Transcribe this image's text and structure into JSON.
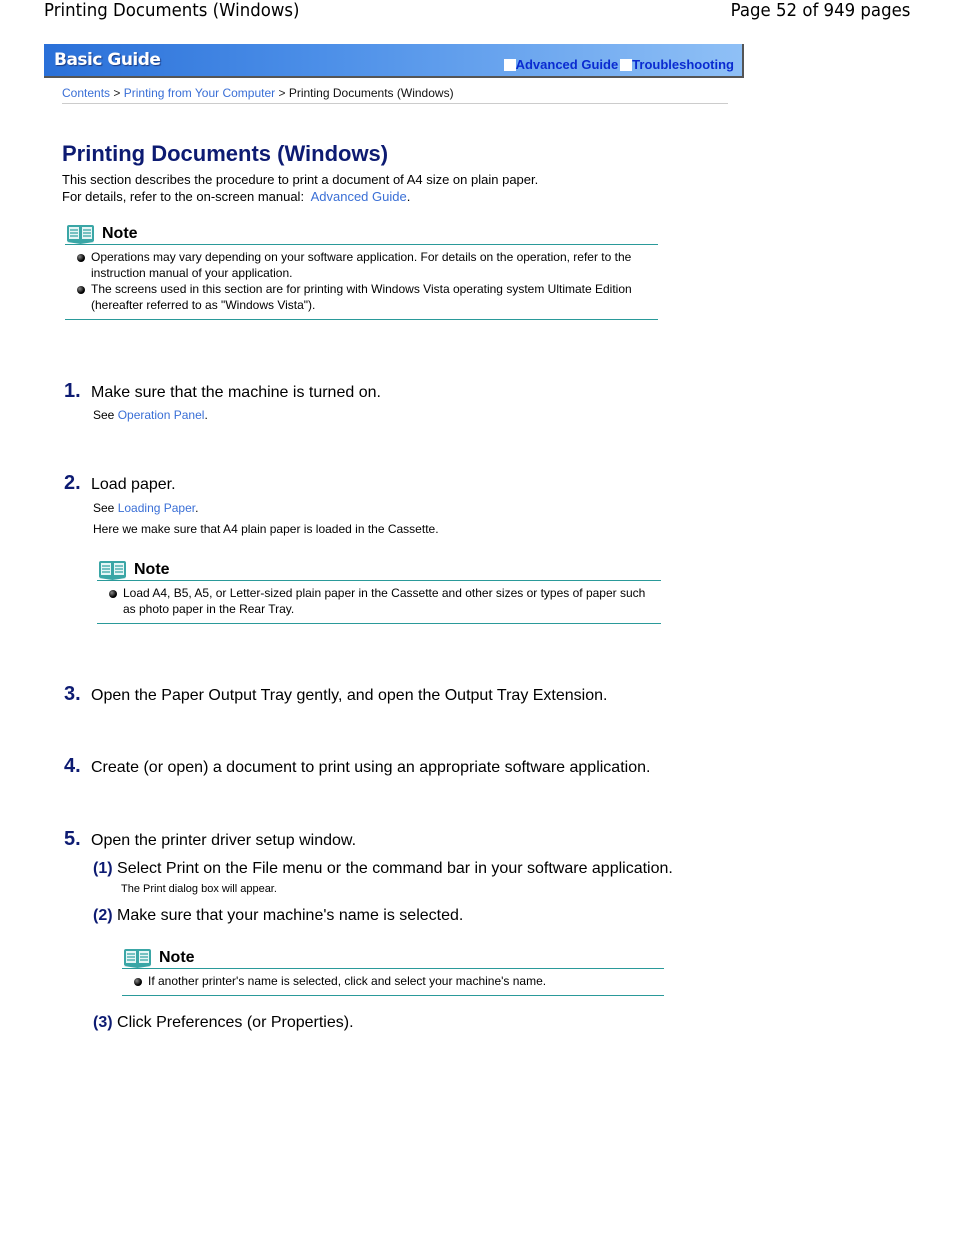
{
  "pdf_header": {
    "title": "Printing Documents (Windows)",
    "page_info": "Page 52 of 949 pages"
  },
  "banner": {
    "title": "Basic Guide",
    "links": [
      {
        "label": "Advanced Guide"
      },
      {
        "label": "Troubleshooting"
      }
    ],
    "colors": {
      "gradient_start": "#2a70d8",
      "gradient_end": "#8fc0f6",
      "link": "#0a2bd0"
    }
  },
  "breadcrumb": {
    "items": [
      {
        "label": "Contents",
        "link": true
      },
      {
        "label": "Printing from Your Computer",
        "link": true
      },
      {
        "label": "Printing Documents (Windows)",
        "link": false
      }
    ],
    "separator": ">"
  },
  "page": {
    "title": "Printing Documents (Windows)",
    "intro_line1": "This section describes the procedure to print a document of A4 size on plain paper.",
    "intro_line2_prefix": "For details, refer to the on-screen manual:",
    "intro_link": "Advanced Guide",
    "intro_suffix": "."
  },
  "notes": [
    {
      "title": "Note",
      "items": [
        "Operations may vary depending on your software application. For details on the operation, refer to the instruction manual of your application.",
        "The screens used in this section are for printing with Windows Vista operating system Ultimate Edition (hereafter referred to as \"Windows Vista\")."
      ]
    },
    {
      "title": "Note",
      "items": [
        "Load A4, B5, A5, or Letter-sized plain paper in the Cassette and other sizes or types of paper such as photo paper in the Rear Tray."
      ]
    },
    {
      "title": "Note",
      "items": [
        "If another printer's name is selected, click and select your machine's name."
      ]
    }
  ],
  "steps": [
    {
      "num": "1.",
      "text": "Make sure that the machine is turned on.",
      "see_prefix": "See",
      "see_link": "Operation Panel",
      "see_suffix": "."
    },
    {
      "num": "2.",
      "text": "Load paper.",
      "see_prefix": "See",
      "see_link": "Loading Paper",
      "see_suffix": ".",
      "extra": "Here we make sure that A4 plain paper is loaded in the Cassette."
    },
    {
      "num": "3.",
      "text": "Open the Paper Output Tray gently, and open the Output Tray Extension."
    },
    {
      "num": "4.",
      "text": "Create (or open) a document to print using an appropriate software application."
    },
    {
      "num": "5.",
      "text": "Open the printer driver setup window.",
      "substeps": [
        {
          "num": "(1)",
          "text": "Select Print on the File menu or the command bar in your software application.",
          "detail": "The Print dialog box will appear."
        },
        {
          "num": "(2)",
          "text": "Make sure that your machine's name is selected."
        },
        {
          "num": "(3)",
          "text": "Click Preferences (or Properties)."
        }
      ]
    }
  ],
  "icons": {
    "note": "open-book-icon",
    "bullet": "round-bullet-icon"
  },
  "colors": {
    "heading": "#0d1b72",
    "link": "#3a6fd6",
    "note_rule": "#2a9a9a"
  }
}
